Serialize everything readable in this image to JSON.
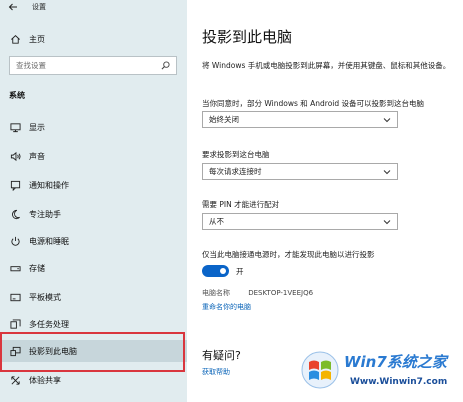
{
  "window": {
    "title": "设置"
  },
  "sidebar": {
    "home_label": "主页",
    "search_placeholder": "查找设置",
    "section_label": "系统",
    "items": [
      {
        "label": "显示",
        "icon": "monitor-icon"
      },
      {
        "label": "声音",
        "icon": "speaker-icon"
      },
      {
        "label": "通知和操作",
        "icon": "notification-icon"
      },
      {
        "label": "专注助手",
        "icon": "moon-icon"
      },
      {
        "label": "电源和睡眠",
        "icon": "power-icon"
      },
      {
        "label": "存储",
        "icon": "storage-icon"
      },
      {
        "label": "平板模式",
        "icon": "tablet-icon"
      },
      {
        "label": "多任务处理",
        "icon": "multitask-icon"
      },
      {
        "label": "投影到此电脑",
        "icon": "project-icon",
        "selected": true
      },
      {
        "label": "体验共享",
        "icon": "share-icon"
      }
    ]
  },
  "main": {
    "title": "投影到此电脑",
    "description": "将 Windows 手机或电脑投影到此屏幕，并使用其键盘、鼠标和其他设备。",
    "setting1": {
      "label": "当你同意时，部分 Windows 和 Android 设备可以投影到这台电脑",
      "value": "始终关闭"
    },
    "setting2": {
      "label": "要求投影到这台电脑",
      "value": "每次请求连接时"
    },
    "setting3": {
      "label": "需要 PIN 才能进行配对",
      "value": "从不"
    },
    "setting4": {
      "label": "仅当此电脑接通电源时，才能发现此电脑以进行投影",
      "toggle_state": "开",
      "toggle_on": true
    },
    "pc_name_label": "电脑名称",
    "pc_name_value": "DESKTOP-1VEEJQ6",
    "rename_link": "重命名你的电脑",
    "help_title": "有疑问?",
    "help_link": "获取帮助"
  },
  "watermark": {
    "text1": "Win7系统之家",
    "text2": "Www.Winwin7.com"
  },
  "colors": {
    "sidebar_bg": "#e1ecef",
    "accent": "#0a64c8",
    "highlight_border": "#d9363e"
  }
}
